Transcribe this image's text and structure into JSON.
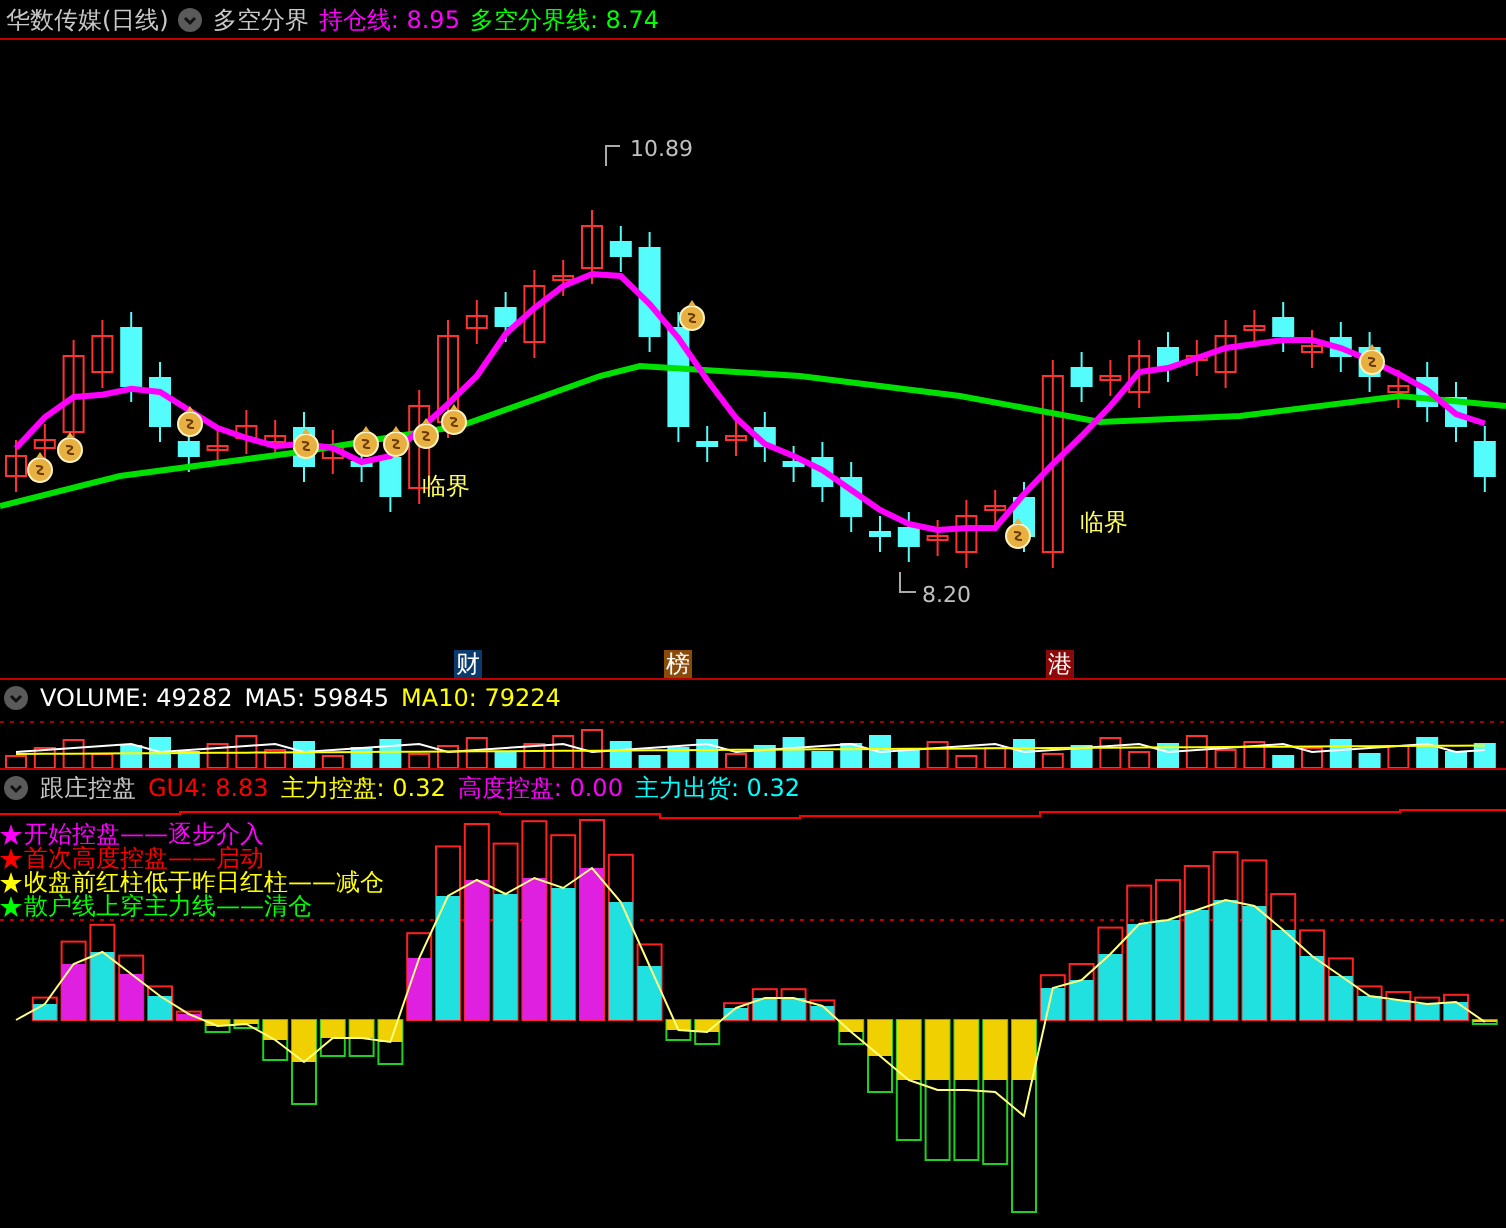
{
  "header": {
    "title": "华数传媒(日线)",
    "indicator": "多空分界",
    "values": [
      {
        "text": "持仓线: 8.95",
        "color": "#ff00ff"
      },
      {
        "text": "多空分界线: 8.74",
        "color": "#00ff00"
      }
    ]
  },
  "price_chart": {
    "high_label": "10.89",
    "low_label": "8.20",
    "signals": [
      {
        "text": "临界"
      },
      {
        "text": "临界"
      }
    ],
    "events": [
      {
        "text": "财",
        "color": "#0a3a6e"
      },
      {
        "text": "榜",
        "color": "#8a4a0a"
      },
      {
        "text": "港",
        "color": "#8a0a0a"
      }
    ]
  },
  "volume": {
    "values": [
      {
        "text": "VOLUME: 49282",
        "color": "#ffffff"
      },
      {
        "text": "MA5: 59845",
        "color": "#ffffff"
      },
      {
        "text": "MA10: 79224",
        "color": "#ffff00"
      }
    ]
  },
  "control": {
    "indicator": "跟庄控盘",
    "values": [
      {
        "text": "GU4: 8.83",
        "color": "#ff0000"
      },
      {
        "text": "主力控盘: 0.32",
        "color": "#ffff00"
      },
      {
        "text": "高度控盘: 0.00",
        "color": "#ff00ff"
      },
      {
        "text": "主力出货: 0.32",
        "color": "#00ffff"
      }
    ],
    "legend": [
      {
        "text": "开始控盘——逐步介入",
        "color": "#ff00ff"
      },
      {
        "text": "首次高度控盘——启动",
        "color": "#ff0000"
      },
      {
        "text": "收盘前红柱低于昨日红柱——减仓",
        "color": "#ffff00"
      },
      {
        "text": "散户线上穿主力线——清仓",
        "color": "#00ff00"
      }
    ]
  }
}
